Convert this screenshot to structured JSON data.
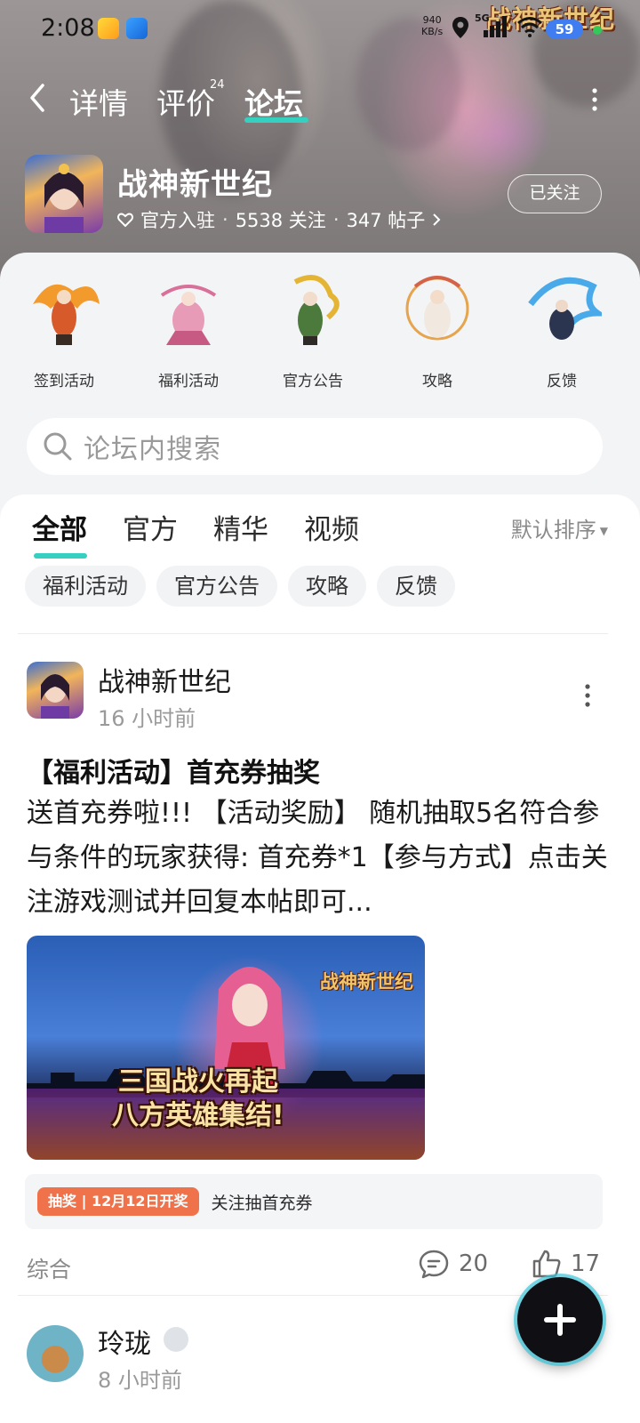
{
  "status_bar": {
    "time": "2:08",
    "net_speed_value": "940",
    "net_speed_unit": "KB/s",
    "network_type": "5G",
    "battery": "59"
  },
  "nav": {
    "tabs": [
      {
        "label": "详情"
      },
      {
        "label": "评价",
        "count": "24"
      },
      {
        "label": "论坛",
        "active": true
      }
    ],
    "hero_logo_text": "战神新世纪"
  },
  "game": {
    "title": "战神新世纪",
    "official_label": "官方入驻",
    "followers": "5538 关注",
    "posts": "347 帖子",
    "follow_button": "已关注"
  },
  "categories": [
    {
      "label": "签到活动",
      "icon": "phoenix-hero-art"
    },
    {
      "label": "福利活动",
      "icon": "dancer-hero-art"
    },
    {
      "label": "官方公告",
      "icon": "dragon-general-art"
    },
    {
      "label": "攻略",
      "icon": "mage-hero-art"
    },
    {
      "label": "反馈",
      "icon": "ice-dragon-art"
    }
  ],
  "search": {
    "placeholder": "论坛内搜索"
  },
  "filter_tabs": [
    "全部",
    "官方",
    "精华",
    "视频"
  ],
  "sort_label": "默认排序",
  "chips": [
    "福利活动",
    "官方公告",
    "攻略",
    "反馈"
  ],
  "posts": [
    {
      "author": "战神新世纪",
      "time": "16 小时前",
      "title": "【福利活动】首充券抽奖",
      "body": "送首充券啦!!! 【活动奖励】 随机抽取5名符合参与条件的玩家获得: 首充券*1【参与方式】点击关注游戏测试并回复本帖即可...",
      "image_logo": "战神新世纪",
      "image_slogan_1": "三国战火再起",
      "image_slogan_2": "八方英雄集结!",
      "lottery_tag": "抽奖 | 12月12日开奖",
      "lottery_text": "关注抽首充券",
      "category": "综合",
      "comments": "20",
      "likes": "17"
    },
    {
      "author": "玲珑",
      "time": "8 小时前"
    }
  ],
  "colors": {
    "accent": "#36d0c0",
    "lottery_tag": "#f0724a",
    "battery": "#3f7df0"
  }
}
